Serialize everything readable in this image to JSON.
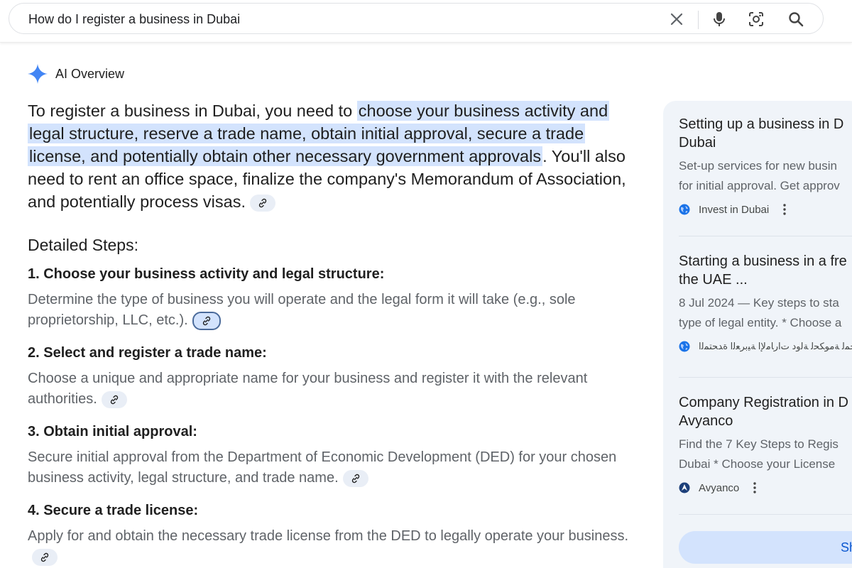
{
  "search": {
    "query": "How do I register a business in Dubai"
  },
  "ai_overview": {
    "label": "AI Overview",
    "intro_before": "To register a business in Dubai, you need to ",
    "intro_highlight": "choose your business activity and legal structure, reserve a trade name, obtain initial approval, secure a trade license, and potentially obtain other necessary government approvals",
    "intro_after": ". You'll also need to rent an office space, finalize the company's Memorandum of Association, and potentially process visas.",
    "steps_title": "Detailed Steps:",
    "steps": [
      {
        "title": "1. Choose your business activity and legal structure:",
        "desc": "Determine the type of business you will operate and the legal form it will take (e.g., sole proprietorship, LLC, etc.)."
      },
      {
        "title": "2. Select and register a trade name:",
        "desc": "Choose a unique and appropriate name for your business and register it with the relevant authorities."
      },
      {
        "title": "3. Obtain initial approval:",
        "desc": "Secure initial approval from the Department of Economic Development (DED) for your chosen business activity, legal structure, and trade name."
      },
      {
        "title": "4. Secure a trade license:",
        "desc": "Apply for and obtain the necessary trade license from the DED to legally operate your business."
      }
    ]
  },
  "sources": {
    "cards": [
      {
        "title_line1": "Setting up a business in D",
        "title_line2": "Dubai",
        "snippet_line1": "Set-up services for new busin",
        "snippet_line2": "for initial approval. Get approv",
        "source": "Invest in Dubai"
      },
      {
        "title_line1": "Starting a business in a fre",
        "title_line2": "the UAE ...",
        "snippet_line1": "8 Jul 2024 — Key steps to sta",
        "snippet_line2": "type of legal entity. * Choose a",
        "source": "ﺔﻴﻤﺳﺮﻟا ﺔﺑﺍﻮﺒﻟا ﺔﺤﻤﻟ ﺔﻣﻮﻜﺤﻟ ﺔﻟﻭﺩ ﺕﺍﺭﺎﻣﻹا ﺔﻴﺑﺮﻌﻟا ﺓﺪﺤﺘﻤﻟا"
      },
      {
        "title_line1": "Company Registration in D",
        "title_line2": "Avyanco",
        "snippet_line1": "Find the 7 Key Steps to Regis",
        "snippet_line2": "Dubai * Choose your License",
        "source": "Avyanco"
      }
    ],
    "show_all_label": "Sh"
  },
  "colors": {
    "highlight": "#d3e3fd",
    "spark": "#4285f4",
    "panel_bg": "#f0f4f9"
  },
  "icons": [
    "close-icon",
    "microphone-icon",
    "camera-lens-icon",
    "search-icon",
    "sparkle-icon",
    "link-icon",
    "globe-icon",
    "more-vert-icon"
  ]
}
